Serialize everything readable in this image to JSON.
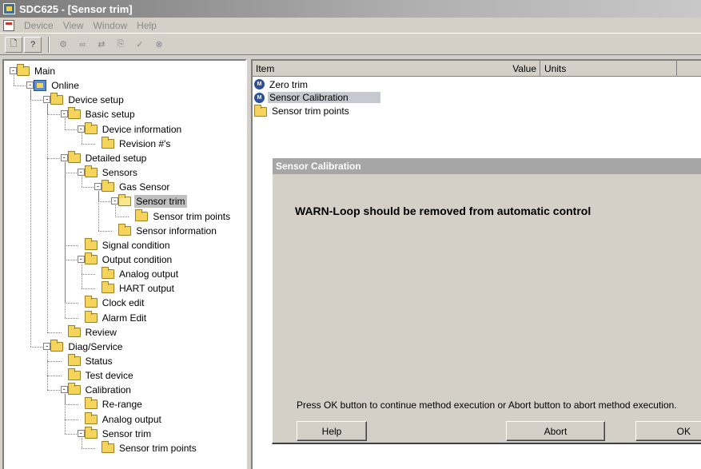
{
  "window": {
    "title": "SDC625 - [Sensor trim]"
  },
  "menu": [
    "Device",
    "View",
    "Window",
    "Help"
  ],
  "toolbar": [
    "new-icon",
    "help-cursor-icon",
    "settings-icon",
    "binoculars-icon",
    "transfer-icon",
    "export-icon",
    "check-icon",
    "close-device-icon"
  ],
  "tree": [
    {
      "label": "Main",
      "level": 0,
      "exp": "-",
      "icon": "folder"
    },
    {
      "label": "Online",
      "level": 1,
      "exp": "-",
      "icon": "online"
    },
    {
      "label": "Device setup",
      "level": 2,
      "exp": "-",
      "icon": "folder"
    },
    {
      "label": "Basic setup",
      "level": 3,
      "exp": "-",
      "icon": "folder"
    },
    {
      "label": "Device information",
      "level": 4,
      "exp": "-",
      "icon": "folder"
    },
    {
      "label": "Revision #'s",
      "level": 5,
      "exp": "",
      "icon": "folder"
    },
    {
      "label": "Detailed setup",
      "level": 3,
      "exp": "-",
      "icon": "folder"
    },
    {
      "label": "Sensors",
      "level": 4,
      "exp": "-",
      "icon": "folder"
    },
    {
      "label": "Gas Sensor",
      "level": 5,
      "exp": "-",
      "icon": "folder"
    },
    {
      "label": "Sensor trim",
      "level": 6,
      "exp": "-",
      "icon": "folder-open",
      "selected": true
    },
    {
      "label": "Sensor trim points",
      "level": 7,
      "exp": "",
      "icon": "folder"
    },
    {
      "label": "Sensor information",
      "level": 6,
      "exp": "",
      "icon": "folder"
    },
    {
      "label": "Signal condition",
      "level": 4,
      "exp": "",
      "icon": "folder"
    },
    {
      "label": "Output condition",
      "level": 4,
      "exp": "-",
      "icon": "folder"
    },
    {
      "label": "Analog output",
      "level": 5,
      "exp": "",
      "icon": "folder"
    },
    {
      "label": "HART output",
      "level": 5,
      "exp": "",
      "icon": "folder"
    },
    {
      "label": "Clock edit",
      "level": 4,
      "exp": "",
      "icon": "folder"
    },
    {
      "label": "Alarm Edit",
      "level": 4,
      "exp": "",
      "icon": "folder"
    },
    {
      "label": "Review",
      "level": 3,
      "exp": "",
      "icon": "folder"
    },
    {
      "label": "Diag/Service",
      "level": 2,
      "exp": "-",
      "icon": "folder"
    },
    {
      "label": "Status",
      "level": 3,
      "exp": "",
      "icon": "folder"
    },
    {
      "label": "Test device",
      "level": 3,
      "exp": "",
      "icon": "folder"
    },
    {
      "label": "Calibration",
      "level": 3,
      "exp": "-",
      "icon": "folder"
    },
    {
      "label": "Re-range",
      "level": 4,
      "exp": "",
      "icon": "folder"
    },
    {
      "label": "Analog output",
      "level": 4,
      "exp": "",
      "icon": "folder"
    },
    {
      "label": "Sensor trim",
      "level": 4,
      "exp": "-",
      "icon": "folder"
    },
    {
      "label": "Sensor trim points",
      "level": 5,
      "exp": "",
      "icon": "folder"
    }
  ],
  "list": {
    "columns": [
      "Item",
      "Value",
      "Units"
    ],
    "rows": [
      {
        "label": "Zero trim",
        "icon": "method-icon"
      },
      {
        "label": "Sensor Calibration",
        "icon": "method-icon",
        "selected": true
      },
      {
        "label": "Sensor trim points",
        "icon": "folder-icon"
      }
    ]
  },
  "dialog": {
    "title": "Sensor Calibration",
    "warning": "WARN-Loop should be removed from automatic control",
    "prompt": "Press OK button to continue method execution or Abort button to abort method execution.",
    "buttons": {
      "help": "Help",
      "abort": "Abort",
      "ok": "OK"
    }
  }
}
